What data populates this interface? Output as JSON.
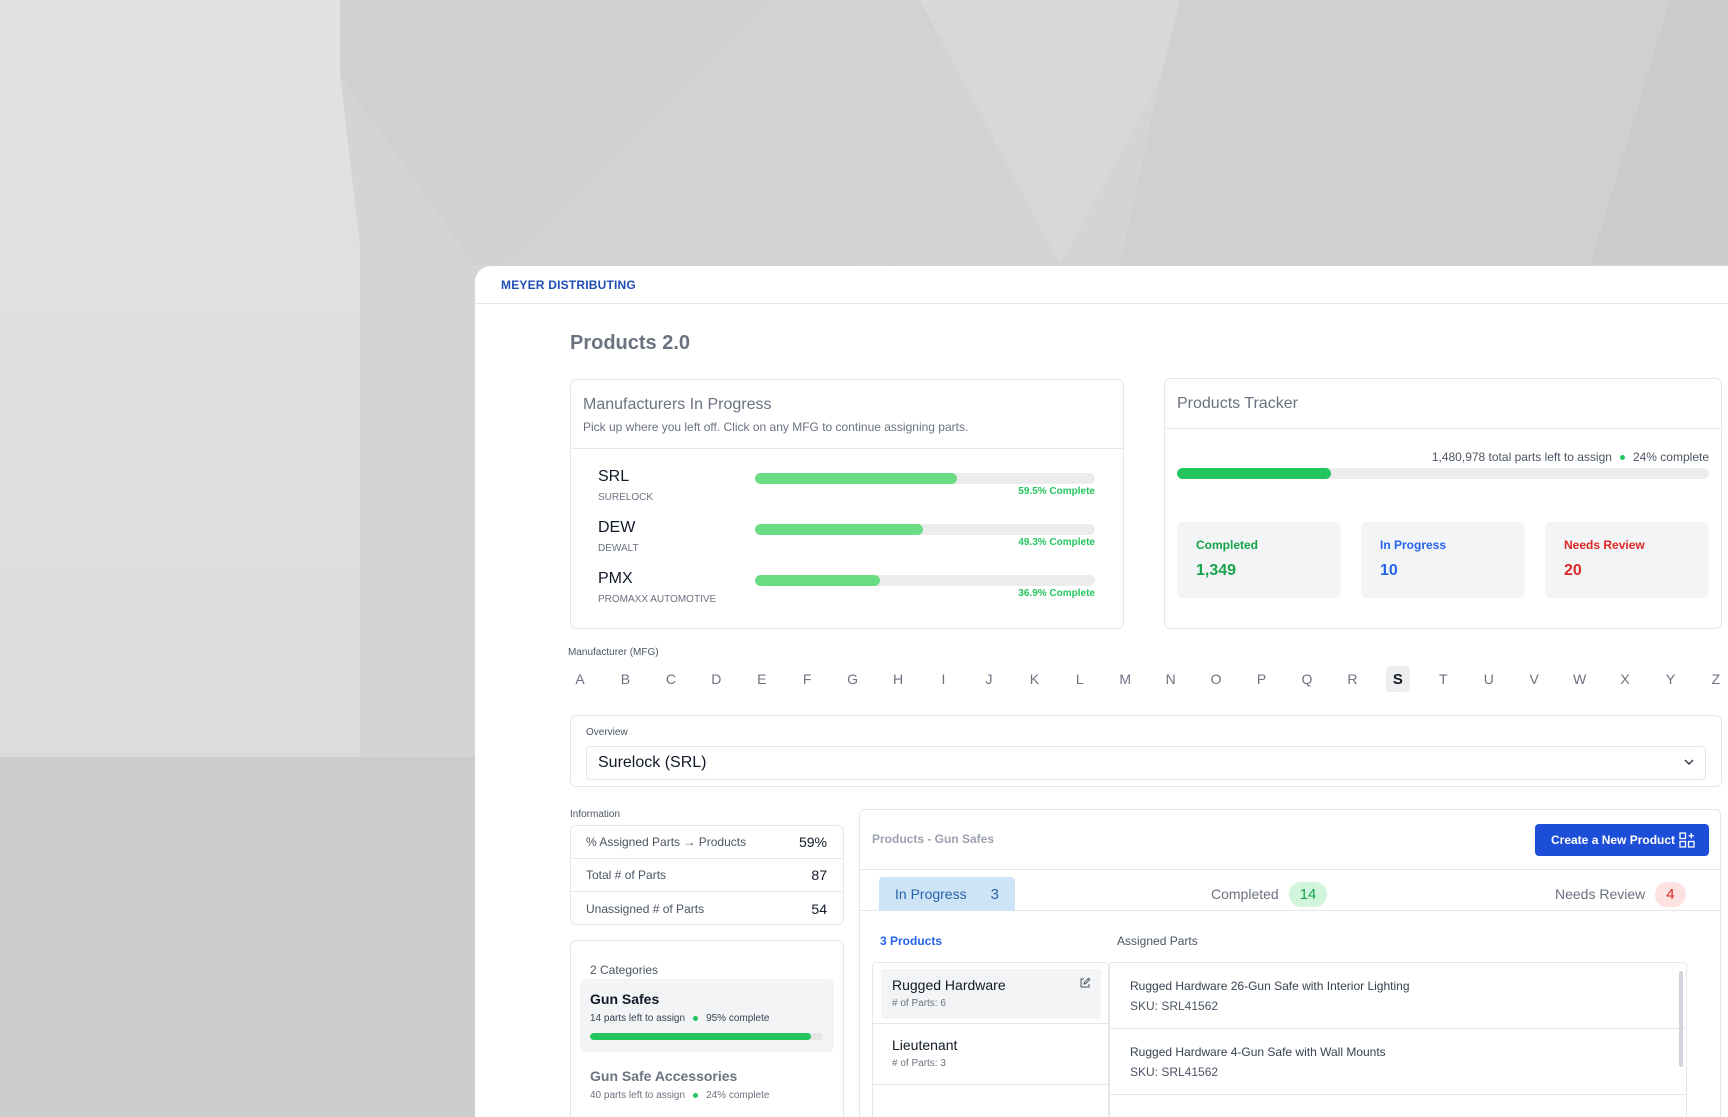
{
  "brand": "MEYER DISTRIBUTING",
  "page_title": "Products 2.0",
  "manufacturers": {
    "title": "Manufacturers In Progress",
    "subtitle": "Pick up where you left off. Click on any MFG to continue assigning parts.",
    "items": [
      {
        "code": "SRL",
        "name": "SURELOCK",
        "progress": 59.5,
        "label": "59.5% Complete"
      },
      {
        "code": "DEW",
        "name": "DEWALT",
        "progress": 49.3,
        "label": "49.3% Complete"
      },
      {
        "code": "PMX",
        "name": "PROMAXX AUTOMOTIVE",
        "progress": 36.9,
        "label": "36.9% Complete"
      }
    ]
  },
  "tracker": {
    "title": "Products Tracker",
    "parts_left": "1,480,978 total parts left to assign",
    "complete_label": "24% complete",
    "progress": 29,
    "stats": [
      {
        "label": "Completed",
        "value": "1,349",
        "color": "#16a34a"
      },
      {
        "label": "In Progress",
        "value": "10",
        "color": "#2563eb"
      },
      {
        "label": "Needs Review",
        "value": "20",
        "color": "#dc2626"
      }
    ]
  },
  "alphabet": {
    "label": "Manufacturer (MFG)",
    "letters": [
      "A",
      "B",
      "C",
      "D",
      "E",
      "F",
      "G",
      "H",
      "I",
      "J",
      "K",
      "L",
      "M",
      "N",
      "O",
      "P",
      "Q",
      "R",
      "S",
      "T",
      "U",
      "V",
      "W",
      "X",
      "Y",
      "Z"
    ],
    "active": "S"
  },
  "overview": {
    "label": "Overview",
    "selected": "Surelock (SRL)"
  },
  "information": {
    "label": "Information",
    "rows": [
      {
        "key": "% Assigned Parts → Products",
        "value": "59%"
      },
      {
        "key": "Total # of Parts",
        "value": "87"
      },
      {
        "key": "Unassigned # of Parts",
        "value": "54"
      }
    ]
  },
  "categories": {
    "title": "2 Categories",
    "items": [
      {
        "name": "Gun Safes",
        "parts_left": "14 parts left to assign",
        "complete": "95% complete",
        "progress": 95
      },
      {
        "name": "Gun Safe Accessories",
        "parts_left": "40 parts left to assign",
        "complete": "24% complete",
        "progress": 24
      }
    ]
  },
  "products": {
    "title": "Products - Gun Safes",
    "create_label": "Create a New Product",
    "tabs": [
      {
        "label": "In Progress",
        "count": "3"
      },
      {
        "label": "Completed",
        "count": "14"
      },
      {
        "label": "Needs Review",
        "count": "4"
      }
    ],
    "products_count": "3 Products",
    "assigned_label": "Assigned Parts",
    "list": [
      {
        "name": "Rugged Hardware",
        "parts": "# of Parts: 6"
      },
      {
        "name": "Lieutenant",
        "parts": "# of Parts: 3"
      }
    ],
    "assigned": [
      {
        "name": "Rugged Hardware 26-Gun Safe with Interior Lighting",
        "sku": "SKU: SRL41562"
      },
      {
        "name": "Rugged Hardware 4-Gun Safe with Wall Mounts",
        "sku": "SKU: SRL41562"
      }
    ]
  }
}
